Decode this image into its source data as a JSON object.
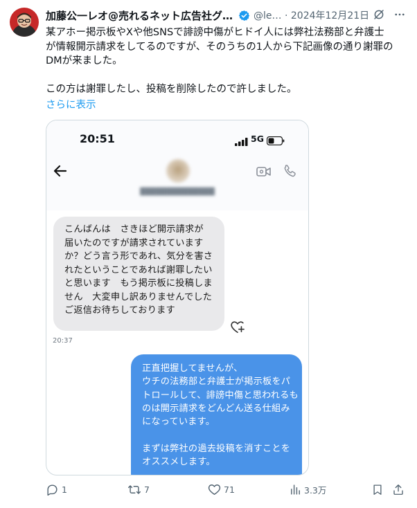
{
  "tweet": {
    "author_name": "加藤公一レオ@売れるネット広告社グ…",
    "handle": "@le…",
    "separator": "·",
    "date": "2024年12月21日",
    "text": "某アホー掲示板やXや他SNSで誹謗中傷がヒドイ人には弊社法務部と弁護士\nが情報開示請求をしてるのですが、そのうちの1人から下記画像の通り謝罪の\nDMが来ました。\n\nこの方は謝罪したし、投稿を削除したので許しました。",
    "show_more": "さらに表示"
  },
  "screenshot": {
    "status_time": "20:51",
    "network": "5G",
    "incoming_message": "こんばんは　さきほど開示請求が\n届いたのですが請求されていますか？どう言う形であれ、気分を害されたということであれば謝罪したいと思います　もう掲示板に投稿しません　大変申し訳ありませんでした　ご返信お待ちしております",
    "incoming_time": "20:37",
    "outgoing_message": "正直把握してませんが、\nウチの法務部と弁護士が掲示板をパトロールして、誹謗中傷と思われるものは開示請求をどんどん送る仕組みになっています。\n\nまずは弊社の過去投稿を消すことをオススメします。"
  },
  "actions": {
    "replies": "1",
    "reposts": "7",
    "likes": "71",
    "views": "3.3万"
  },
  "colors": {
    "accent": "#1d9bf0",
    "secondary_text": "#536471",
    "outgoing_bubble": "#4a93e8",
    "incoming_bubble": "#e9e9eb"
  }
}
